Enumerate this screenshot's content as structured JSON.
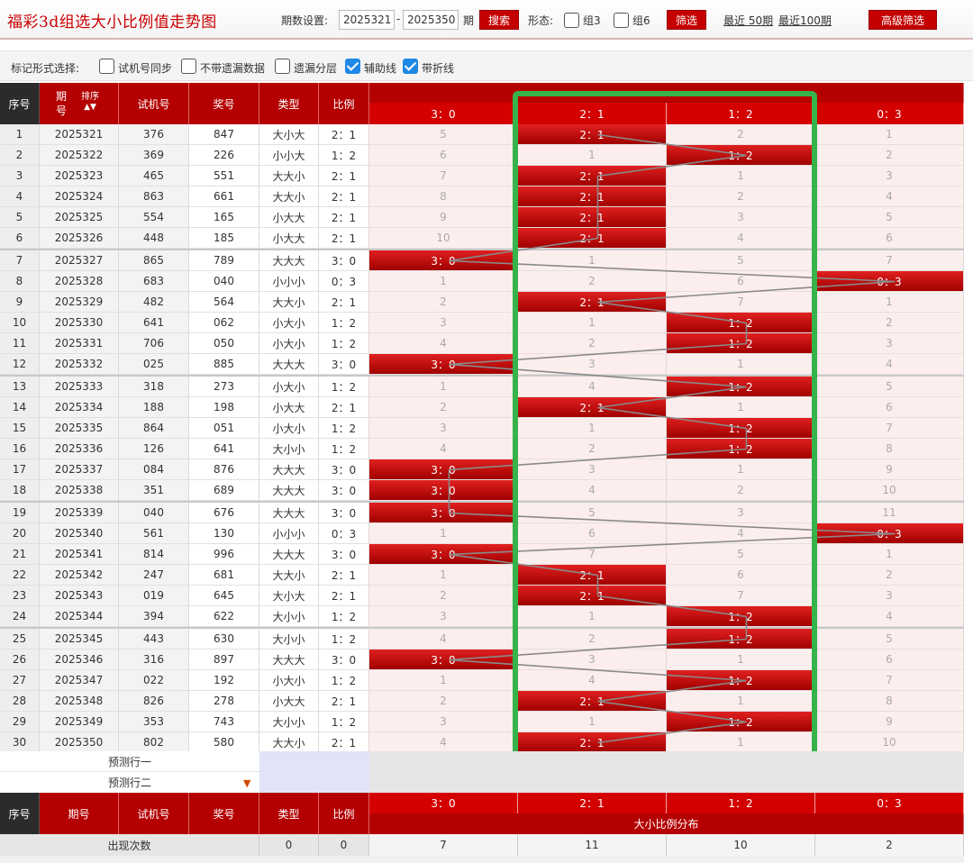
{
  "header": {
    "title": "福彩3d组选大小比例值走势图",
    "period_label": "期数设置:",
    "period_from": "2025321",
    "dash": "-",
    "period_to": "2025350",
    "period_unit": "期",
    "search_label": "搜索",
    "form_label": "形态:",
    "group3_label": "组3",
    "group6_label": "组6",
    "filter_label": "筛选",
    "recent50_label": "最近 50期",
    "recent100_label": "最近100期",
    "advanced_label": "高级筛选"
  },
  "markrow": {
    "label": "标记形式选择:",
    "options": [
      {
        "label": "试机号同步",
        "checked": false
      },
      {
        "label": "不带遗漏数据",
        "checked": false
      },
      {
        "label": "遗漏分层",
        "checked": false
      },
      {
        "label": "辅助线",
        "checked": true
      },
      {
        "label": "带折线",
        "checked": true
      }
    ]
  },
  "table": {
    "headers": {
      "idx": "序号",
      "period_top": "期",
      "period_bottom": "号",
      "sort": "排序",
      "test": "试机号",
      "prize": "奖号",
      "type": "类型",
      "ratio": "比例",
      "dist": "大小比例分布"
    },
    "ratio_cols": [
      "3：0",
      "2：1",
      "1：2",
      "0：3"
    ],
    "rows": [
      {
        "n": "1",
        "p": "2025321",
        "t": "376",
        "k": "847",
        "ty": "大小大",
        "r": "2：1",
        "hit": 1,
        "m": [
          5,
          0,
          2,
          1
        ]
      },
      {
        "n": "2",
        "p": "2025322",
        "t": "369",
        "k": "226",
        "ty": "小小大",
        "r": "1：2",
        "hit": 2,
        "m": [
          6,
          1,
          0,
          2
        ]
      },
      {
        "n": "3",
        "p": "2025323",
        "t": "465",
        "k": "551",
        "ty": "大大小",
        "r": "2：1",
        "hit": 1,
        "m": [
          7,
          0,
          1,
          3
        ]
      },
      {
        "n": "4",
        "p": "2025324",
        "t": "863",
        "k": "661",
        "ty": "大大小",
        "r": "2：1",
        "hit": 1,
        "m": [
          8,
          0,
          2,
          4
        ]
      },
      {
        "n": "5",
        "p": "2025325",
        "t": "554",
        "k": "165",
        "ty": "小大大",
        "r": "2：1",
        "hit": 1,
        "m": [
          9,
          0,
          3,
          5
        ]
      },
      {
        "n": "6",
        "p": "2025326",
        "t": "448",
        "k": "185",
        "ty": "小大大",
        "r": "2：1",
        "hit": 1,
        "m": [
          10,
          0,
          4,
          6
        ]
      },
      {
        "n": "7",
        "p": "2025327",
        "t": "865",
        "k": "789",
        "ty": "大大大",
        "r": "3：0",
        "hit": 0,
        "m": [
          0,
          1,
          5,
          7
        ]
      },
      {
        "n": "8",
        "p": "2025328",
        "t": "683",
        "k": "040",
        "ty": "小小小",
        "r": "0：3",
        "hit": 3,
        "m": [
          1,
          2,
          6,
          0
        ]
      },
      {
        "n": "9",
        "p": "2025329",
        "t": "482",
        "k": "564",
        "ty": "大大小",
        "r": "2：1",
        "hit": 1,
        "m": [
          2,
          0,
          7,
          1
        ]
      },
      {
        "n": "10",
        "p": "2025330",
        "t": "641",
        "k": "062",
        "ty": "小大小",
        "r": "1：2",
        "hit": 2,
        "m": [
          3,
          1,
          0,
          2
        ]
      },
      {
        "n": "11",
        "p": "2025331",
        "t": "706",
        "k": "050",
        "ty": "小大小",
        "r": "1：2",
        "hit": 2,
        "m": [
          4,
          2,
          0,
          3
        ]
      },
      {
        "n": "12",
        "p": "2025332",
        "t": "025",
        "k": "885",
        "ty": "大大大",
        "r": "3：0",
        "hit": 0,
        "m": [
          0,
          3,
          1,
          4
        ]
      },
      {
        "n": "13",
        "p": "2025333",
        "t": "318",
        "k": "273",
        "ty": "小大小",
        "r": "1：2",
        "hit": 2,
        "m": [
          1,
          4,
          0,
          5
        ]
      },
      {
        "n": "14",
        "p": "2025334",
        "t": "188",
        "k": "198",
        "ty": "小大大",
        "r": "2：1",
        "hit": 1,
        "m": [
          2,
          0,
          1,
          6
        ]
      },
      {
        "n": "15",
        "p": "2025335",
        "t": "864",
        "k": "051",
        "ty": "小大小",
        "r": "1：2",
        "hit": 2,
        "m": [
          3,
          1,
          0,
          7
        ]
      },
      {
        "n": "16",
        "p": "2025336",
        "t": "126",
        "k": "641",
        "ty": "大小小",
        "r": "1：2",
        "hit": 2,
        "m": [
          4,
          2,
          0,
          8
        ]
      },
      {
        "n": "17",
        "p": "2025337",
        "t": "084",
        "k": "876",
        "ty": "大大大",
        "r": "3：0",
        "hit": 0,
        "m": [
          0,
          3,
          1,
          9
        ]
      },
      {
        "n": "18",
        "p": "2025338",
        "t": "351",
        "k": "689",
        "ty": "大大大",
        "r": "3：0",
        "hit": 0,
        "m": [
          0,
          4,
          2,
          10
        ]
      },
      {
        "n": "19",
        "p": "2025339",
        "t": "040",
        "k": "676",
        "ty": "大大大",
        "r": "3：0",
        "hit": 0,
        "m": [
          0,
          5,
          3,
          11
        ]
      },
      {
        "n": "20",
        "p": "2025340",
        "t": "561",
        "k": "130",
        "ty": "小小小",
        "r": "0：3",
        "hit": 3,
        "m": [
          1,
          6,
          4,
          0
        ]
      },
      {
        "n": "21",
        "p": "2025341",
        "t": "814",
        "k": "996",
        "ty": "大大大",
        "r": "3：0",
        "hit": 0,
        "m": [
          0,
          7,
          5,
          1
        ]
      },
      {
        "n": "22",
        "p": "2025342",
        "t": "247",
        "k": "681",
        "ty": "大大小",
        "r": "2：1",
        "hit": 1,
        "m": [
          1,
          0,
          6,
          2
        ]
      },
      {
        "n": "23",
        "p": "2025343",
        "t": "019",
        "k": "645",
        "ty": "大小大",
        "r": "2：1",
        "hit": 1,
        "m": [
          2,
          0,
          7,
          3
        ]
      },
      {
        "n": "24",
        "p": "2025344",
        "t": "394",
        "k": "622",
        "ty": "大小小",
        "r": "1：2",
        "hit": 2,
        "m": [
          3,
          1,
          0,
          4
        ]
      },
      {
        "n": "25",
        "p": "2025345",
        "t": "443",
        "k": "630",
        "ty": "大小小",
        "r": "1：2",
        "hit": 2,
        "m": [
          4,
          2,
          0,
          5
        ]
      },
      {
        "n": "26",
        "p": "2025346",
        "t": "316",
        "k": "897",
        "ty": "大大大",
        "r": "3：0",
        "hit": 0,
        "m": [
          0,
          3,
          1,
          6
        ]
      },
      {
        "n": "27",
        "p": "2025347",
        "t": "022",
        "k": "192",
        "ty": "小大小",
        "r": "1：2",
        "hit": 2,
        "m": [
          1,
          4,
          0,
          7
        ]
      },
      {
        "n": "28",
        "p": "2025348",
        "t": "826",
        "k": "278",
        "ty": "小大大",
        "r": "2：1",
        "hit": 1,
        "m": [
          2,
          0,
          1,
          8
        ]
      },
      {
        "n": "29",
        "p": "2025349",
        "t": "353",
        "k": "743",
        "ty": "大小小",
        "r": "1：2",
        "hit": 2,
        "m": [
          3,
          1,
          0,
          9
        ]
      },
      {
        "n": "30",
        "p": "2025350",
        "t": "802",
        "k": "580",
        "ty": "大大小",
        "r": "2：1",
        "hit": 1,
        "m": [
          4,
          0,
          1,
          10
        ]
      }
    ],
    "predict1": "预测行一",
    "predict2": "预测行二",
    "stats_label": "出现次数",
    "stats_type": "0",
    "stats_ratio": "0",
    "stats": [
      "7",
      "11",
      "10",
      "2"
    ]
  },
  "colors": {
    "accent": "#c40000",
    "highlight_box": "#36b34a",
    "checkbox": "#1e88e5"
  }
}
